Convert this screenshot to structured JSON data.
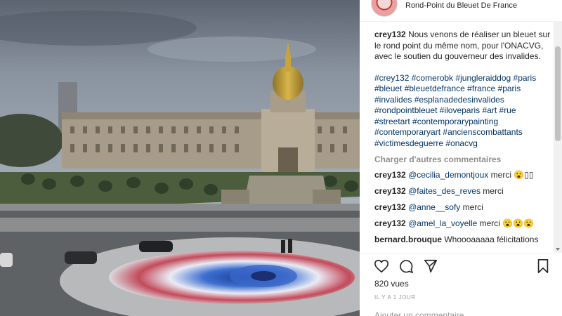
{
  "post": {
    "location": "Rond-Point du Bleuet De France",
    "caption": {
      "username": "crey132",
      "text": "Nous venons de réaliser un bleuet sur le rond point du même nom, pour l'ONACVG, avec le soutien du gouverneur des invalides."
    },
    "hashtags": [
      "#crey132",
      "#comerobk",
      "#jungleraiddog",
      "#paris",
      "#bleuet",
      "#bleuetdefrance",
      "#france",
      "#paris",
      "#invalides",
      "#esplanadedesinvalides",
      "#rondpointbleuet",
      "#iloveparis",
      "#art",
      "#rue",
      "#streetart",
      "#contemporarypainting",
      "#contemporaryart",
      "#ancienscombattants",
      "#victimesdeguerre",
      "#onacvg"
    ],
    "load_more": "Charger d'autres commentaires",
    "comments": [
      {
        "username": "crey132",
        "mention": "@cecilia_demontjoux",
        "text": " merci 😮▯▯"
      },
      {
        "username": "crey132",
        "mention": "@faites_des_reves",
        "text": " merci"
      },
      {
        "username": "crey132",
        "mention": "@anne__sofy",
        "text": " merci"
      },
      {
        "username": "crey132",
        "mention": "@amel_la_voyelle",
        "text": " merci 😮😮😮"
      },
      {
        "username": "bernard.brouque",
        "mention": "",
        "text": "Whoooaaaaa félicitations"
      }
    ],
    "views": "820 vues",
    "date": "IL Y A 1 JOUR",
    "add_comment": "Ajouter un commentaire..."
  },
  "icons": [
    "heart-icon",
    "comment-icon",
    "share-icon",
    "bookmark-icon"
  ],
  "colors": {
    "link": "#003569",
    "text": "#262626",
    "muted": "#8e8e8e",
    "sky": "#7d8894",
    "dome": "#c9a33c"
  }
}
